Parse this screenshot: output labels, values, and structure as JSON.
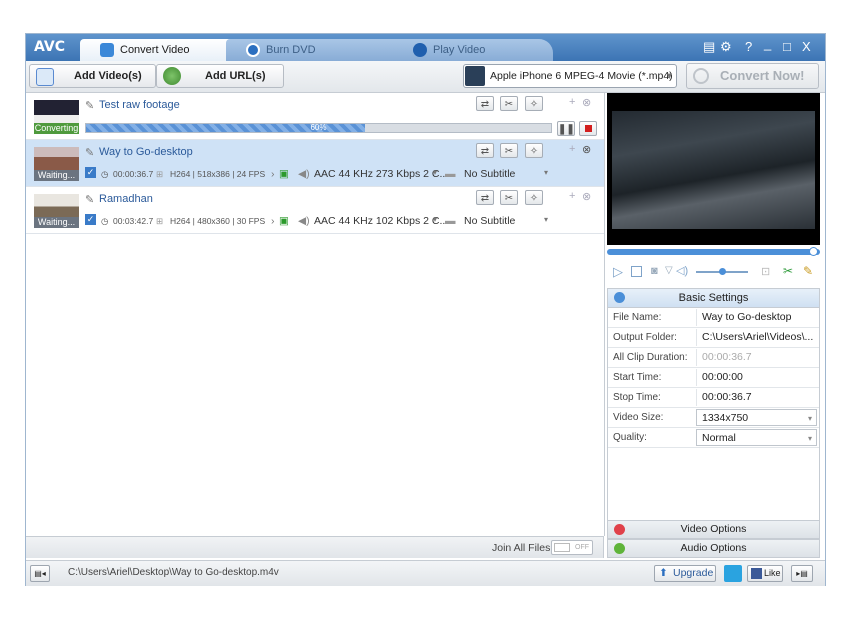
{
  "app": {
    "logo": "AVC",
    "tabs": [
      {
        "label": "Convert Video"
      },
      {
        "label": "Burn DVD"
      },
      {
        "label": "Play Video"
      }
    ],
    "window_controls": [
      "▤",
      "⚙",
      "?",
      "_",
      "□",
      "X"
    ]
  },
  "toolbar": {
    "add_video_label": "Add Video(s)",
    "add_url_label": "Add URL(s)",
    "profile": "Apple iPhone 6 MPEG-4 Movie (*.mp4)",
    "convert_label": "Convert Now!"
  },
  "files": [
    {
      "name": "Test raw footage",
      "status": "Converting",
      "progress": 0.6,
      "progress_label": "60%"
    },
    {
      "name": "Way to Go-desktop",
      "status": "Waiting...",
      "duration": "00:00:36.7",
      "video": "H264 | 518x386 | 24 FPS",
      "audio": "AAC 44 KHz 273 Kbps 2 C...",
      "subtitle": "No Subtitle"
    },
    {
      "name": "Ramadhan",
      "status": "Waiting...",
      "duration": "00:03:42.7",
      "video": "H264 | 480x360 | 30 FPS",
      "audio": "AAC 44 KHz 102 Kbps 2 C...",
      "subtitle": "No Subtitle"
    }
  ],
  "join": {
    "label": "Join All Files",
    "toggle": "OFF"
  },
  "settings": {
    "title": "Basic Settings",
    "rows": [
      {
        "label": "File Name:",
        "value": "Way to Go-desktop"
      },
      {
        "label": "Output Folder:",
        "value": "C:\\Users\\Ariel\\Videos\\..."
      },
      {
        "label": "All Clip Duration:",
        "value": "00:00:36.7"
      },
      {
        "label": "Start Time:",
        "value": "00:00:00"
      },
      {
        "label": "Stop Time:",
        "value": "00:00:36.7"
      },
      {
        "label": "Video Size:",
        "value": "1334x750"
      },
      {
        "label": "Quality:",
        "value": "Normal"
      }
    ],
    "video_options": "Video Options",
    "audio_options": "Audio Options"
  },
  "statusbar": {
    "path": "C:\\Users\\Ariel\\Desktop\\Way to Go-desktop.m4v",
    "upgrade": "Upgrade",
    "like": "Like"
  },
  "colors": {
    "accent": "#3c74b4",
    "selected_row": "#cfe2f6",
    "converting": "#4f9a3d",
    "progress": "#5a92d6"
  }
}
